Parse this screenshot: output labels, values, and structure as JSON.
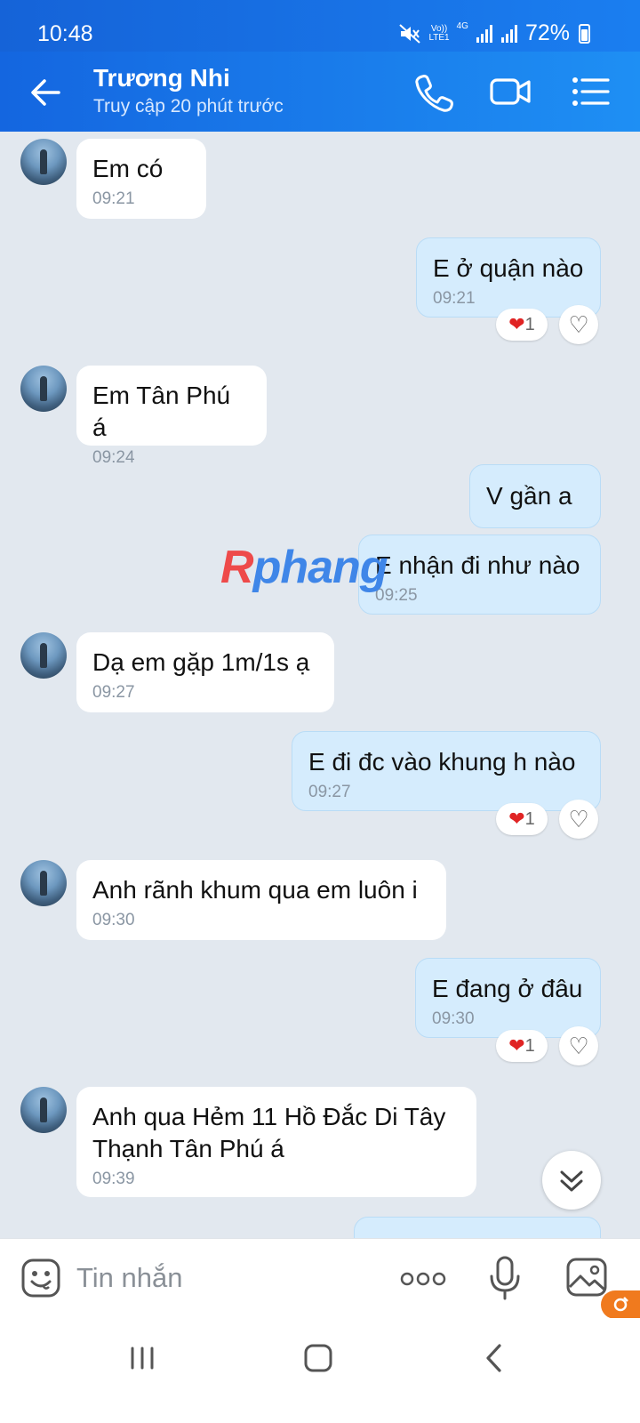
{
  "status_bar": {
    "time": "10:48",
    "net_top": "Vo))",
    "net_bottom": "LTE1",
    "net_type": "4G",
    "battery": "72%"
  },
  "header": {
    "contact_name": "Trương Nhi",
    "last_seen": "Truy cập 20 phút trước",
    "icons": [
      "back-arrow-icon",
      "phone-icon",
      "video-call-icon",
      "menu-icon"
    ]
  },
  "messages": [
    {
      "dir": "in",
      "text": "Em có",
      "time": "09:21"
    },
    {
      "dir": "out",
      "text": "E ở quận nào",
      "time": "09:21",
      "reaction": "1"
    },
    {
      "dir": "in",
      "text": "Em Tân Phú á",
      "time": "09:24"
    },
    {
      "dir": "out",
      "text": "V gần a",
      "time": ""
    },
    {
      "dir": "out",
      "text": "E nhận đi như nào",
      "time": "09:25"
    },
    {
      "dir": "in",
      "text": "Dạ em gặp 1m/1s ạ",
      "time": "09:27"
    },
    {
      "dir": "out",
      "text": "E đi đc vào khung h nào",
      "time": "09:27",
      "reaction": "1"
    },
    {
      "dir": "in",
      "text": "Anh rãnh khum qua em luôn i",
      "time": "09:30"
    },
    {
      "dir": "out",
      "text": "E đang ở đâu",
      "time": "09:30",
      "reaction": "1"
    },
    {
      "dir": "in",
      "text_line1": "Anh qua Hẻm 11 Hồ Đắc Di Tây",
      "text_line2": "Thạnh Tân Phú á",
      "time": "09:39"
    }
  ],
  "watermark": "Rphang",
  "input": {
    "placeholder": "Tin nhắn"
  },
  "colors": {
    "header_blue": "#1a7ef0",
    "out_bubble": "#d5ecfd",
    "in_bubble": "#ffffff",
    "chat_bg": "#e2e8ef",
    "heart_red": "#e02424"
  }
}
